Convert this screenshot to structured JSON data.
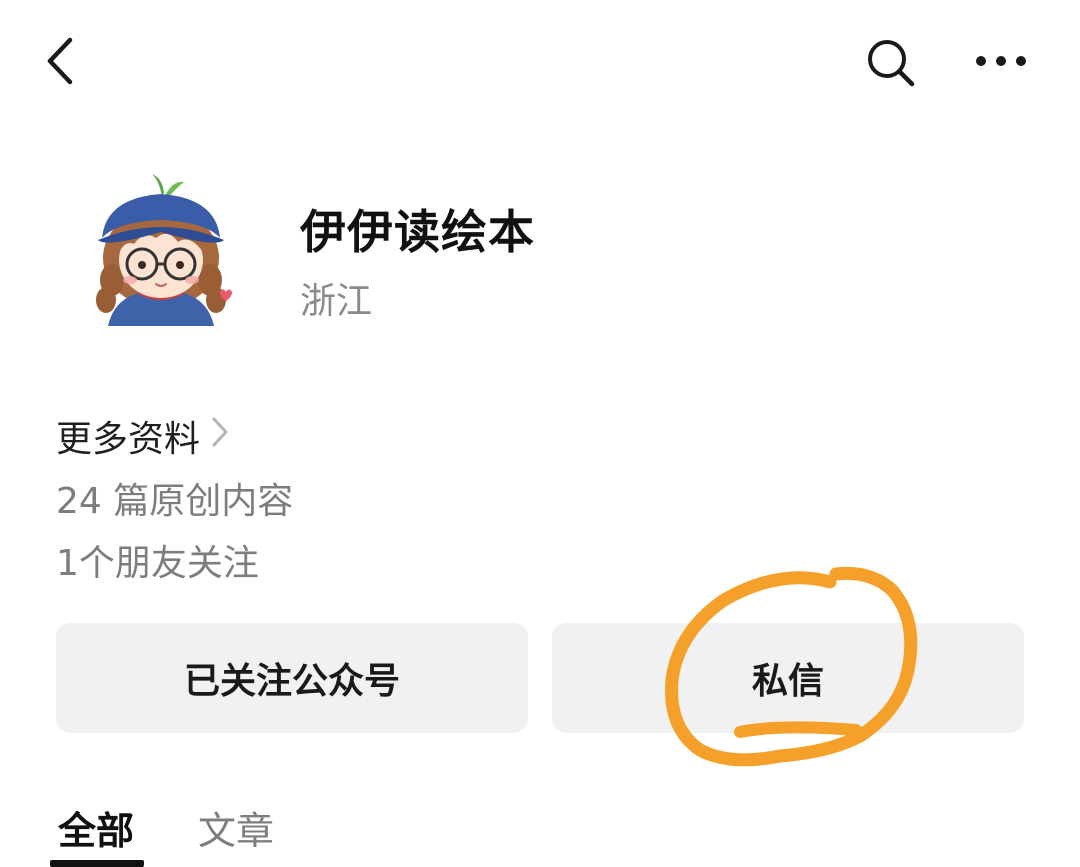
{
  "header": {
    "back_icon": "chevron-left-icon",
    "search_icon": "search-icon",
    "more_icon": "more-horizontal-icon"
  },
  "profile": {
    "name": "伊伊读绘本",
    "region": "浙江",
    "avatar": "cartoon-girl-avatar"
  },
  "info": {
    "more_label": "更多资料",
    "articles_count": "24 篇原创内容",
    "friends_follow": "1个朋友关注"
  },
  "actions": {
    "follow_label": "已关注公众号",
    "message_label": "私信"
  },
  "tabs": [
    {
      "label": "全部",
      "active": true
    },
    {
      "label": "文章",
      "active": false
    }
  ],
  "colors": {
    "annotation": "#f5a02a",
    "button_bg": "#f1f1f1",
    "secondary_text": "#8a8a8a"
  }
}
